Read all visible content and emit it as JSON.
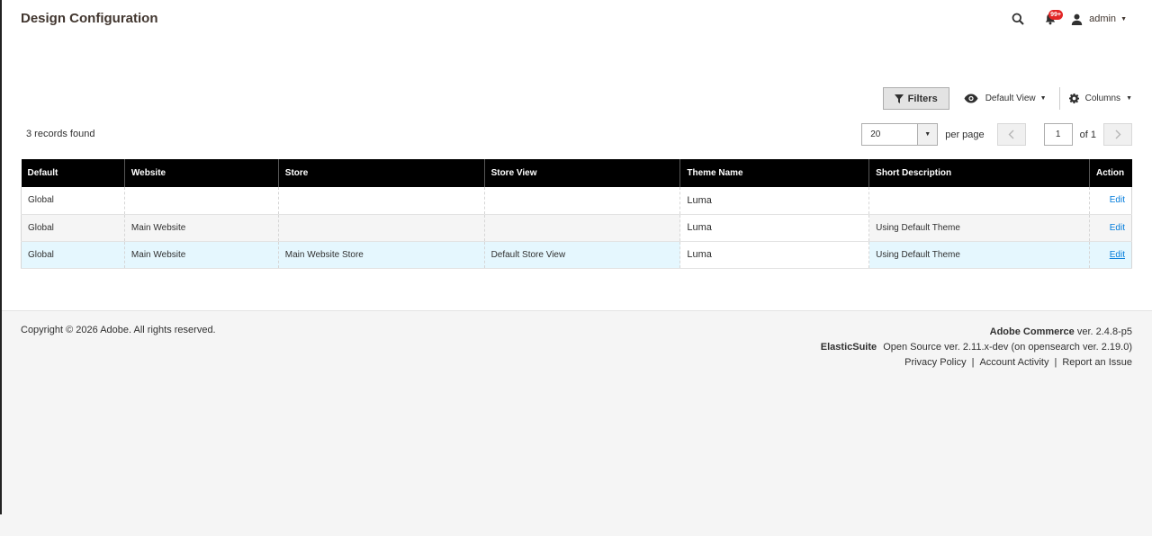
{
  "header": {
    "title": "Design Configuration",
    "notification_count": "99+",
    "user_name": "admin"
  },
  "toolbar": {
    "filters_label": "Filters",
    "view_label": "Default View",
    "columns_label": "Columns"
  },
  "grid": {
    "records_found": "3 records found",
    "per_page_value": "20",
    "per_page_label": "per page",
    "current_page": "1",
    "page_total": "of 1",
    "columns": [
      "Default",
      "Website",
      "Store",
      "Store View",
      "Theme Name",
      "Short Description",
      "Action"
    ],
    "rows": [
      {
        "default": "Global",
        "website": "",
        "store": "",
        "store_view": "",
        "theme": "Luma",
        "description": "",
        "action": "Edit"
      },
      {
        "default": "Global",
        "website": "Main Website",
        "store": "",
        "store_view": "",
        "theme": "Luma",
        "description": "Using Default Theme",
        "action": "Edit"
      },
      {
        "default": "Global",
        "website": "Main Website",
        "store": "Main Website Store",
        "store_view": "Default Store View",
        "theme": "Luma",
        "description": "Using Default Theme",
        "action": "Edit"
      }
    ]
  },
  "footer": {
    "copyright": "Copyright © 2026 Adobe. All rights reserved.",
    "product_name": "Adobe Commerce",
    "product_version": "ver. 2.4.8-p5",
    "elasticsuite_name": "ElasticSuite",
    "elasticsuite_version": "Open Source ver. 2.11.x-dev (on opensearch ver. 2.19.0)",
    "links": [
      "Privacy Policy",
      "Account Activity",
      "Report an Issue"
    ]
  },
  "colors": {
    "link": "#007bdb",
    "header_bg": "#000000",
    "badge": "#e22626",
    "row_hover": "#e5f7fe"
  }
}
